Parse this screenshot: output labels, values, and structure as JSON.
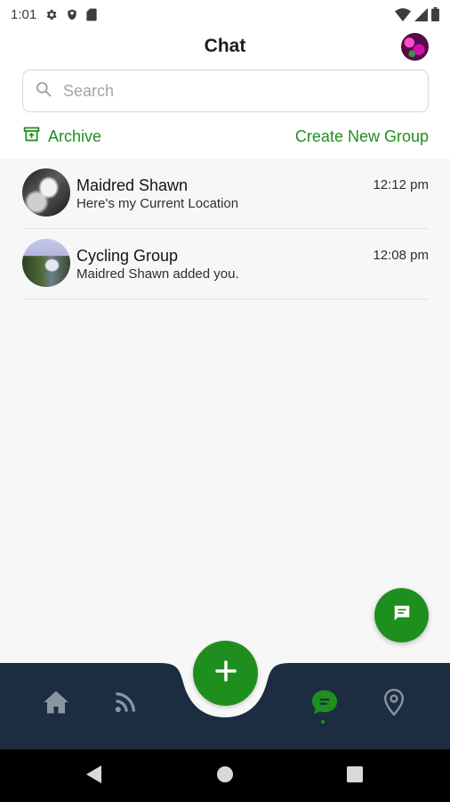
{
  "status_bar": {
    "time": "1:01"
  },
  "header": {
    "title": "Chat"
  },
  "search": {
    "placeholder": "Search",
    "value": ""
  },
  "actions": {
    "archive_label": "Archive",
    "create_group_label": "Create New Group"
  },
  "chats": [
    {
      "name": "Maidred Shawn",
      "preview": "Here's my Current Location",
      "time": "12:12 pm"
    },
    {
      "name": "Cycling Group",
      "preview": "Maidred Shawn added you.",
      "time": "12:08 pm"
    }
  ],
  "colors": {
    "accent": "#1e8f1e",
    "nav_background": "#1d2d41",
    "nav_icon_inactive": "#8a96a4"
  },
  "icons": {
    "status": [
      "settings-icon",
      "shield-icon",
      "sd-card-icon",
      "wifi-icon",
      "signal-icon",
      "battery-icon"
    ],
    "nav": [
      "home-icon",
      "feed-icon",
      "add-icon",
      "chat-icon",
      "location-pin-icon"
    ],
    "fab": "message-icon"
  },
  "bottom_nav": {
    "active": "chat"
  }
}
